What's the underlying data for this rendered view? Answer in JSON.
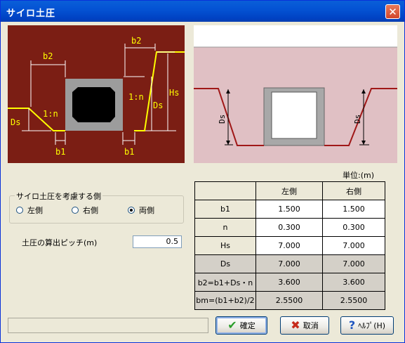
{
  "window": {
    "title": "サイロ土圧",
    "close_glyph": "✕"
  },
  "diagram_left": {
    "labels": {
      "b2_left": "b2",
      "b2_right": "b2",
      "slope_left": "1:n",
      "slope_right": "1:n",
      "ds_left": "Ds",
      "ds_right": "Ds",
      "hs": "Hs",
      "b1_left": "b1",
      "b1_right": "b1"
    },
    "colors": {
      "background": "#7b1e14",
      "lines": "#ffff00",
      "box_outer": "#9c9c9c",
      "box_inner": "#000000"
    }
  },
  "diagram_right": {
    "labels": {
      "ds_left": "Ds",
      "ds_right": "Ds"
    },
    "colors": {
      "background": "#e0c0c4",
      "line": "#a01818",
      "top_band": "#ffffff"
    }
  },
  "side_group": {
    "title": "サイロ土圧を考慮する側",
    "options": [
      {
        "label": "左側",
        "selected": false
      },
      {
        "label": "右側",
        "selected": false
      },
      {
        "label": "両側",
        "selected": true
      }
    ]
  },
  "pitch": {
    "label": "土圧の算出ピッチ(m)",
    "value": "0.5"
  },
  "unit_label": "単位:(m)",
  "table": {
    "headers": [
      "",
      "左側",
      "右側"
    ],
    "rows": [
      {
        "label": "b1",
        "left": "1.500",
        "right": "1.500",
        "editable": true
      },
      {
        "label": "n",
        "left": "0.300",
        "right": "0.300",
        "editable": true
      },
      {
        "label": "Hs",
        "left": "7.000",
        "right": "7.000",
        "editable": true
      },
      {
        "label": "Ds",
        "left": "7.000",
        "right": "7.000",
        "editable": false
      },
      {
        "label": "b2=b1+Ds・n",
        "left": "3.600",
        "right": "3.600",
        "editable": false
      },
      {
        "label": "bm=(b1+b2)/2",
        "left": "2.5500",
        "right": "2.5500",
        "editable": false
      }
    ]
  },
  "buttons": {
    "ok": "確定",
    "cancel": "取消",
    "help": "ﾍﾙﾌﾟ(H)"
  },
  "icons": {
    "ok": "check-icon",
    "cancel": "x-icon",
    "help": "question-icon"
  }
}
